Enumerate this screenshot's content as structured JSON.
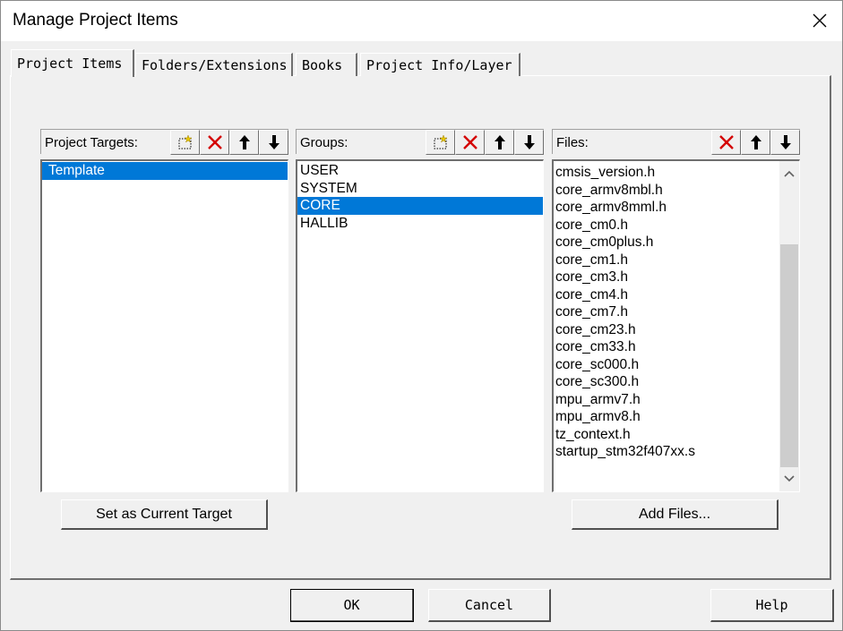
{
  "window": {
    "title": "Manage Project Items"
  },
  "tabs": [
    {
      "label": "Project Items"
    },
    {
      "label": "Folders/Extensions"
    },
    {
      "label": "Books"
    },
    {
      "label": "Project Info/Layer"
    }
  ],
  "targets": {
    "label": "Project Targets:",
    "items": [
      "Template"
    ],
    "selected": 0
  },
  "groups": {
    "label": "Groups:",
    "items": [
      "USER",
      "SYSTEM",
      "CORE",
      "HALLIB"
    ],
    "selected": 2
  },
  "files": {
    "label": "Files:",
    "items": [
      "cmsis_version.h",
      "core_armv8mbl.h",
      "core_armv8mml.h",
      "core_cm0.h",
      "core_cm0plus.h",
      "core_cm1.h",
      "core_cm3.h",
      "core_cm4.h",
      "core_cm7.h",
      "core_cm23.h",
      "core_cm33.h",
      "core_sc000.h",
      "core_sc300.h",
      "mpu_armv7.h",
      "mpu_armv8.h",
      "tz_context.h",
      "startup_stm32f407xx.s"
    ]
  },
  "buttons": {
    "set_target": "Set as Current Target",
    "add_files": "Add Files...",
    "ok": "OK",
    "cancel": "Cancel",
    "help": "Help"
  },
  "icons": {
    "new": "new-item-icon",
    "delete": "delete-x-icon",
    "up": "move-up-arrow-icon",
    "down": "move-down-arrow-icon",
    "close": "close-icon"
  },
  "colors": {
    "selection": "#0078d7",
    "delete_red": "#d40000"
  }
}
